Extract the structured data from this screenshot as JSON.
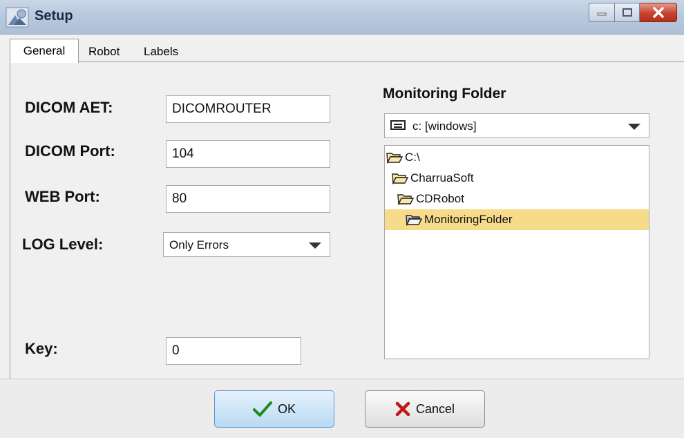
{
  "window": {
    "title": "Setup",
    "buttons": {
      "minimize": "minimize",
      "maximize": "maximize",
      "close": "close"
    }
  },
  "tabs": [
    {
      "label": "General",
      "active": true
    },
    {
      "label": "Robot",
      "active": false
    },
    {
      "label": "Labels",
      "active": false
    }
  ],
  "general": {
    "dicom_aet": {
      "label": "DICOM AET:",
      "value": "DICOMROUTER"
    },
    "dicom_port": {
      "label": "DICOM Port:",
      "value": "104"
    },
    "web_port": {
      "label": "WEB Port:",
      "value": "80"
    },
    "log_level": {
      "label": "LOG Level:",
      "value": "Only Errors"
    },
    "key": {
      "label": "Key:",
      "value": "0"
    }
  },
  "monitoring": {
    "title": "Monitoring Folder",
    "drive": "c: [windows]",
    "folders": [
      {
        "name": "C:\\",
        "level": 0,
        "selected": false
      },
      {
        "name": "CharruaSoft",
        "level": 1,
        "selected": false
      },
      {
        "name": "CDRobot",
        "level": 2,
        "selected": false
      },
      {
        "name": "MonitoringFolder",
        "level": 3,
        "selected": true
      }
    ]
  },
  "actions": {
    "ok_label": "OK",
    "cancel_label": "Cancel"
  },
  "colors": {
    "selection": "#f6dc8a",
    "ok_check": "#1f8a1f",
    "cancel_x": "#c01818",
    "close_button": "#c8432d"
  },
  "icons": {
    "app": "setup-app-icon",
    "drive": "hard-drive-icon",
    "folder": "folder-icon",
    "folder_open": "open-folder-icon",
    "ok": "checkmark-icon",
    "cancel": "x-icon"
  }
}
